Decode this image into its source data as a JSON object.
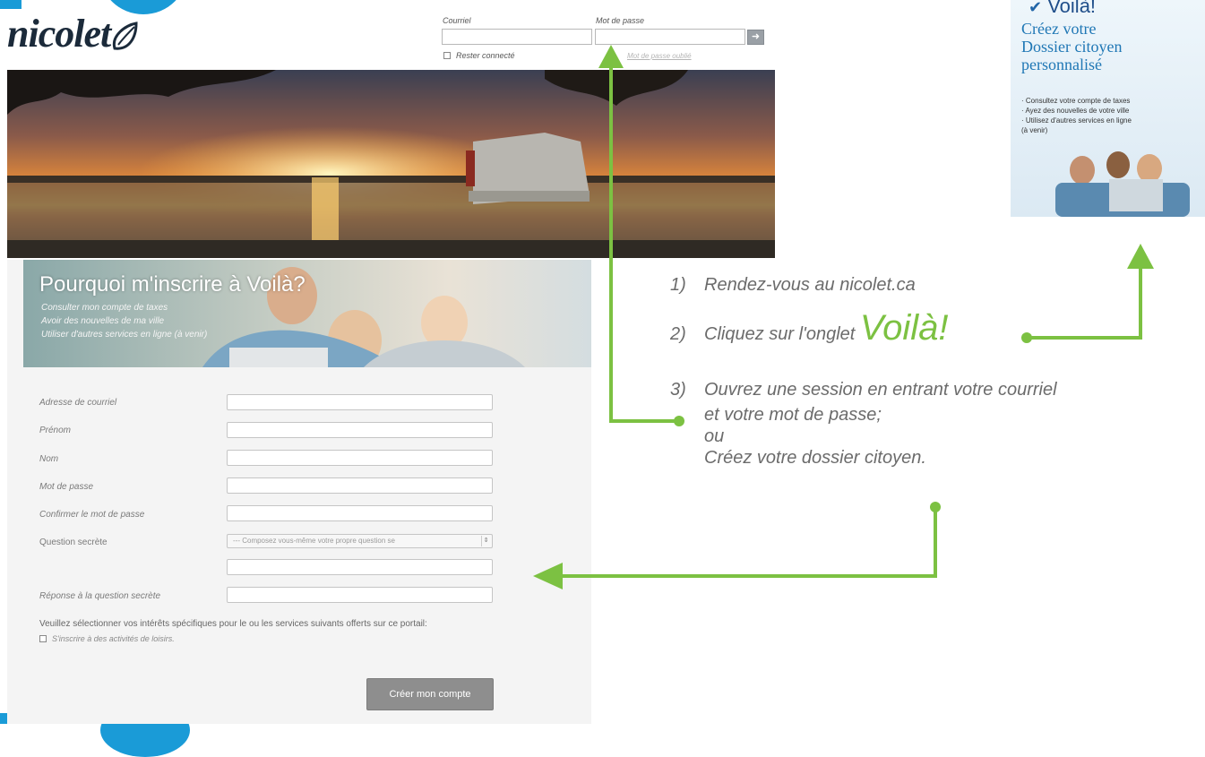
{
  "colors": {
    "accent_green": "#7cc142",
    "blue": "#1a9bd7",
    "promo_blue": "#1f77b5"
  },
  "header": {
    "logo": "nicolet",
    "login": {
      "email_label": "Courriel",
      "password_label": "Mot de passe",
      "remember_label": "Rester connecté",
      "forgot_link": "Mot de passe oublié"
    }
  },
  "promo": {
    "brand": "Voilà!",
    "title_lines": [
      "Créez votre",
      "Dossier citoyen",
      "personnalisé"
    ],
    "bullets": [
      "· Consultez votre compte de taxes",
      "· Ayez des nouvelles de votre ville",
      "· Utilisez d'autres services en ligne",
      "(à venir)"
    ]
  },
  "signup": {
    "banner_title": "Pourquoi m'inscrire à Voilà?",
    "banner_lines": [
      "Consulter mon compte de taxes",
      "Avoir des nouvelles de ma ville",
      "Utiliser d'autres services en ligne (à venir)"
    ],
    "fields": [
      {
        "label": "Adresse de courriel"
      },
      {
        "label": "Prénom"
      },
      {
        "label": "Nom"
      },
      {
        "label": "Mot de passe"
      },
      {
        "label": "Confirmer le mot de passe"
      },
      {
        "label": "Question secrète"
      },
      {
        "label": "Réponse à la question secrète"
      }
    ],
    "question_select_value": "--- Composez vous-même votre propre question se",
    "interests_text": "Veuillez sélectionner vos intérêts spécifiques pour le ou les services suivants offerts sur ce portail:",
    "interest_option": "S'inscrire à des activités de loisirs.",
    "create_button": "Créer mon compte"
  },
  "instructions": {
    "step1_num": "1)",
    "step1": "Rendez-vous au nicolet.ca",
    "step2_num": "2)",
    "step2": "Cliquez sur l'onglet",
    "step2_voila": "Voilà!",
    "step3_num": "3)",
    "step3_line1": "Ouvrez une session en entrant votre courriel",
    "step3_line2": "et votre mot de passe;",
    "step3_or": "ou",
    "step3_line3": "Créez votre dossier citoyen."
  }
}
